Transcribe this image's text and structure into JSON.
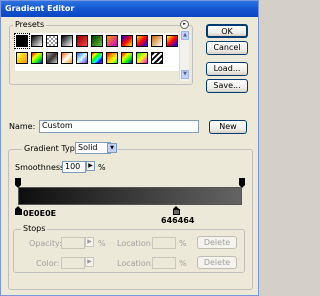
{
  "window": {
    "title": "Gradient Editor"
  },
  "presets": {
    "label": "Presets",
    "menu_icon": "circle-arrow-icon",
    "swatches": [
      {
        "bg": "linear-gradient(135deg,#000,#000)"
      },
      {
        "bg": "linear-gradient(135deg,#000,#fff)"
      },
      {
        "bg": "repeating-conic-gradient(#999 0 25%, #fff 0 50%) 0 0/4px 4px"
      },
      {
        "bg": "linear-gradient(135deg,#000,#fff)"
      },
      {
        "bg": "linear-gradient(135deg,#8b0000,#ff4040)"
      },
      {
        "bg": "linear-gradient(135deg,#003300,#66cc33)"
      },
      {
        "bg": "linear-gradient(135deg,#ff9900,#cc00cc)"
      },
      {
        "bg": "linear-gradient(135deg,#0000cc,#ff0000,#ffff00)"
      },
      {
        "bg": "linear-gradient(135deg,#ffcc00,#ff0000,#0000ff)"
      },
      {
        "bg": "linear-gradient(135deg,#cc6600,#ffffff)"
      },
      {
        "bg": "linear-gradient(135deg,#ffff00,#ff0000,#0000ff)"
      },
      {
        "bg": "linear-gradient(135deg,#ffff99,#ffcc00,#ff9900)"
      },
      {
        "bg": "linear-gradient(135deg,#ff0000,#ffff00,#00ff00,#0000ff)"
      },
      {
        "bg": "linear-gradient(135deg,#999,#333,#ccc)"
      },
      {
        "bg": "linear-gradient(135deg,#ff6600,#ffffff,#ff9900)"
      },
      {
        "bg": "linear-gradient(135deg,#3366ff,#ccffff,#6633cc)"
      },
      {
        "bg": "linear-gradient(135deg,#ff0000,#ffff00,#00ff00,#00ffff,#0000ff,#ff00ff)"
      },
      {
        "bg": "linear-gradient(135deg,#ff0000,#ff9900,#ffff00,#00ff00)"
      },
      {
        "bg": "linear-gradient(135deg,#ff0000,#ffff00,#00ff00,#0000ff)"
      },
      {
        "bg": "linear-gradient(135deg,#00ff00,#ffff00,#ff00ff)"
      },
      {
        "bg": "repeating-linear-gradient(135deg,#000 0 2px,#fff 2px 4px)"
      }
    ]
  },
  "buttons": {
    "ok": "OK",
    "cancel": "Cancel",
    "load": "Load...",
    "save": "Save...",
    "new": "New",
    "delete_opacity": "Delete",
    "delete_color": "Delete"
  },
  "name_field": {
    "label": "Name:",
    "value": "Custom"
  },
  "gradient_type": {
    "label": "Gradient Type:",
    "value": "Solid"
  },
  "smoothness": {
    "label": "Smoothness:",
    "value": "100",
    "unit": "%"
  },
  "stops": {
    "left_color_hex": "0E0E0E",
    "right_color_hex": "646464",
    "left_color": "#0e0e0e",
    "right_color": "#646464"
  },
  "stops_group": {
    "label": "Stops",
    "opacity_label": "Opacity:",
    "opacity_unit": "%",
    "location_label_1": "Location:",
    "location_unit_1": "%",
    "color_label": "Color:",
    "location_label_2": "Location:",
    "location_unit_2": "%"
  }
}
